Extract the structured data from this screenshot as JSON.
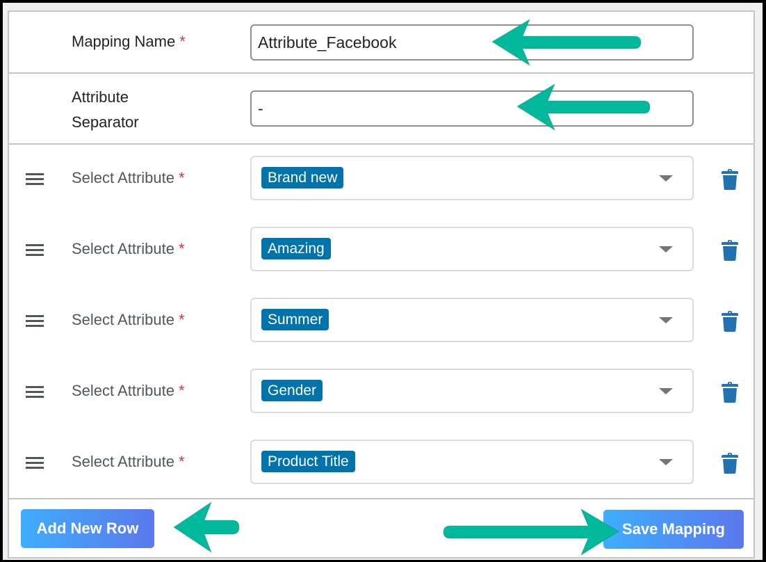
{
  "form": {
    "mapping_name": {
      "label": "Mapping Name",
      "required_mark": "*",
      "value": "Attribute_Facebook"
    },
    "attribute_separator": {
      "label_line1": "Attribute",
      "label_line2": "Separator",
      "value": "-"
    },
    "attribute_rows": [
      {
        "label": "Select Attribute",
        "required_mark": "*",
        "selected": "Brand new"
      },
      {
        "label": "Select Attribute",
        "required_mark": "*",
        "selected": "Amazing"
      },
      {
        "label": "Select Attribute",
        "required_mark": "*",
        "selected": "Summer"
      },
      {
        "label": "Select Attribute",
        "required_mark": "*",
        "selected": "Gender"
      },
      {
        "label": "Select Attribute",
        "required_mark": "*",
        "selected": "Product Title"
      }
    ]
  },
  "actions": {
    "add_row_label": "Add New Row",
    "save_label": "Save Mapping"
  },
  "colors": {
    "tag": "#0073aa",
    "trash": "#2271b1",
    "required": "#d63638",
    "annotation_arrow": "#00b89c"
  }
}
